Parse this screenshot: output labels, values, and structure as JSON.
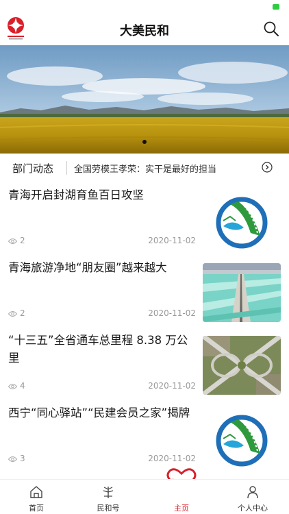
{
  "app": {
    "title": "大美民和"
  },
  "colors": {
    "accent": "#d8202a",
    "status_ok": "#2ecc40"
  },
  "icons": {
    "logo": "logo-icon",
    "search": "search-icon",
    "next": "chevron-right-icon",
    "eye": "eye-icon",
    "home": "home-icon",
    "minhe": "tree-icon",
    "main": "heart-icon",
    "profile": "person-icon"
  },
  "ticker": {
    "label": "部门动态",
    "text": "全国劳模王孝荣：实干是最好的担当"
  },
  "news": [
    {
      "title": "青海开启封湖育鱼百日攻坚",
      "views": "2",
      "date": "2020-11-02",
      "thumb": "logo-thumb"
    },
    {
      "title": "青海旅游净地“朋友圈”越来越大",
      "views": "2",
      "date": "2020-11-02",
      "thumb": "salt-lake-photo"
    },
    {
      "title": "“十三五”全省通车总里程 8.38 万公里",
      "views": "4",
      "date": "2020-11-02",
      "thumb": "interchange-photo"
    },
    {
      "title": "西宁“同心驿站”“民建会员之家”揭牌",
      "views": "3",
      "date": "2020-11-02",
      "thumb": "logo-thumb"
    }
  ],
  "tabs": [
    {
      "label": "首页"
    },
    {
      "label": "民和号"
    },
    {
      "label": "主页"
    },
    {
      "label": "个人中心"
    }
  ]
}
